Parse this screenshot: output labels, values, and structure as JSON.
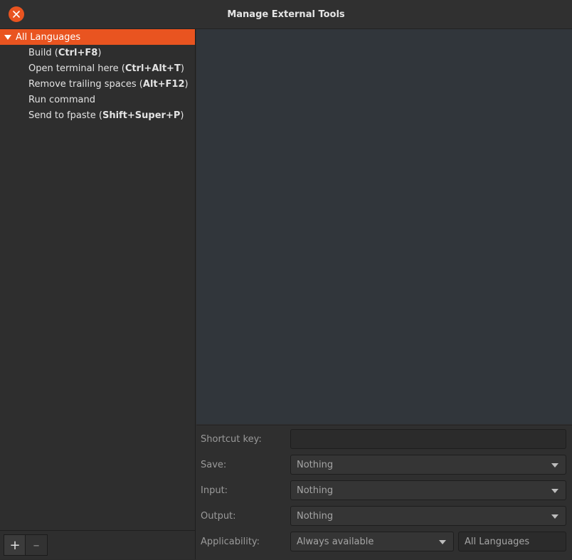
{
  "window": {
    "title": "Manage External Tools"
  },
  "tree": {
    "root_label": "All Languages",
    "items": [
      {
        "name": "Build",
        "shortcut": "Ctrl+F8"
      },
      {
        "name": "Open terminal here",
        "shortcut": "Ctrl+Alt+T"
      },
      {
        "name": "Remove trailing spaces",
        "shortcut": "Alt+F12"
      },
      {
        "name": "Run command",
        "shortcut": ""
      },
      {
        "name": "Send to fpaste",
        "shortcut": "Shift+Super+P"
      }
    ]
  },
  "toolbar": {
    "add_label": "+",
    "remove_label": "–"
  },
  "form": {
    "shortcut_label": "Shortcut key:",
    "shortcut_value": "",
    "save_label": "Save:",
    "save_value": "Nothing",
    "input_label": "Input:",
    "input_value": "Nothing",
    "output_label": "Output:",
    "output_value": "Nothing",
    "applicability_label": "Applicability:",
    "applicability_value": "Always available",
    "language_value": "All Languages"
  },
  "colors": {
    "accent": "#e95420"
  },
  "icons": {
    "close": "close-icon",
    "expander": "triangle-down-icon",
    "dropdown": "chevron-down-icon"
  }
}
